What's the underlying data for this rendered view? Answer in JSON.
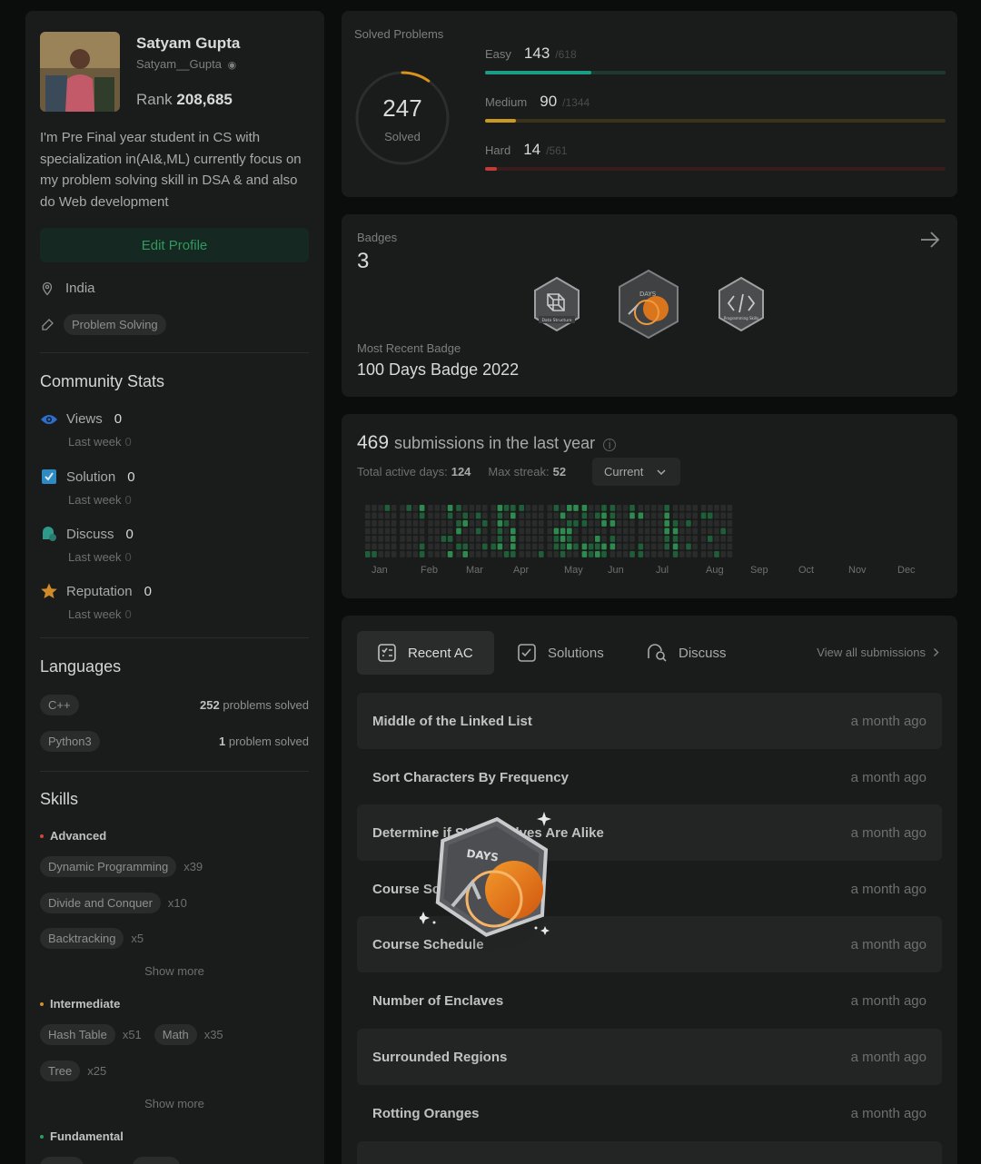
{
  "profile": {
    "name": "Satyam Gupta",
    "username": "Satyam__Gupta",
    "rank_label": "Rank",
    "rank_value": "208,685",
    "bio": "I'm Pre Final year student in CS with specialization in(AI&,ML) currently focus on my problem solving skill in DSA & and also do Web development",
    "edit_label": "Edit Profile",
    "location": "India",
    "tag": "Problem Solving"
  },
  "community": {
    "title": "Community Stats",
    "items": [
      {
        "label": "Views",
        "value": "0",
        "sub_label": "Last week",
        "sub_value": "0",
        "icon": "eye-icon",
        "color": "#2d6fd0"
      },
      {
        "label": "Solution",
        "value": "0",
        "sub_label": "Last week",
        "sub_value": "0",
        "icon": "check-square-icon",
        "color": "#2d8bc4"
      },
      {
        "label": "Discuss",
        "value": "0",
        "sub_label": "Last week",
        "sub_value": "0",
        "icon": "chat-icon",
        "color": "#2f9a8a"
      },
      {
        "label": "Reputation",
        "value": "0",
        "sub_label": "Last week",
        "sub_value": "0",
        "icon": "star-icon",
        "color": "#d08a2a"
      }
    ]
  },
  "languages": {
    "title": "Languages",
    "items": [
      {
        "name": "C++",
        "count": "252",
        "suffix": "problems solved"
      },
      {
        "name": "Python3",
        "count": "1",
        "suffix": "problem solved"
      }
    ]
  },
  "skills": {
    "title": "Skills",
    "show_more": "Show more",
    "advanced": {
      "label": "Advanced",
      "items": [
        {
          "name": "Dynamic Programming",
          "count": "x39"
        },
        {
          "name": "Divide and Conquer",
          "count": "x10"
        },
        {
          "name": "Backtracking",
          "count": "x5"
        }
      ]
    },
    "intermediate": {
      "label": "Intermediate",
      "items": [
        {
          "name": "Hash Table",
          "count": "x51"
        },
        {
          "name": "Math",
          "count": "x35"
        },
        {
          "name": "Tree",
          "count": "x25"
        }
      ]
    },
    "fundamental": {
      "label": "Fundamental"
    }
  },
  "solved": {
    "label": "Solved Problems",
    "total": "247",
    "total_label": "Solved",
    "easy": {
      "label": "Easy",
      "count": "143",
      "total": "/618",
      "fraction": 0.231
    },
    "medium": {
      "label": "Medium",
      "count": "90",
      "total": "/1344",
      "fraction": 0.067
    },
    "hard": {
      "label": "Hard",
      "count": "14",
      "total": "/561",
      "fraction": 0.025
    }
  },
  "badges": {
    "label": "Badges",
    "count": "3",
    "recent_label": "Most Recent Badge",
    "recent_value": "100 Days Badge 2022",
    "items": [
      {
        "name": "data-structure-badge-icon",
        "caption": "Data Structure"
      },
      {
        "name": "days-badge-icon",
        "caption": "DAYS"
      },
      {
        "name": "programming-skills-badge-icon",
        "caption": "Programming Skills"
      }
    ]
  },
  "submissions": {
    "count": "469",
    "text": "submissions in the last year",
    "active_label": "Total active days:",
    "active_value": "124",
    "streak_label": "Max streak:",
    "streak_value": "52",
    "select_value": "Current",
    "months": [
      "Jan",
      "Feb",
      "Mar",
      "Apr",
      "May",
      "Jun",
      "Jul",
      "Aug",
      "Sep",
      "Oct",
      "Nov",
      "Dec"
    ]
  },
  "recent": {
    "tabs": [
      {
        "label": "Recent AC",
        "icon": "list-icon"
      },
      {
        "label": "Solutions",
        "icon": "check-square-icon"
      },
      {
        "label": "Discuss",
        "icon": "chat-search-icon"
      }
    ],
    "view_all": "View all submissions",
    "rows": [
      {
        "title": "Middle of the Linked List",
        "time": "a month ago"
      },
      {
        "title": "Sort Characters By Frequency",
        "time": "a month ago"
      },
      {
        "title": "Determine if String Halves Are Alike",
        "time": "a month ago"
      },
      {
        "title": "Course Schedule II",
        "time": "a month ago"
      },
      {
        "title": "Course Schedule",
        "time": "a month ago"
      },
      {
        "title": "Number of Enclaves",
        "time": "a month ago"
      },
      {
        "title": "Surrounded Regions",
        "time": "a month ago"
      },
      {
        "title": "Rotting Oranges",
        "time": "a month ago"
      }
    ]
  },
  "overlay": {
    "badge_caption": "DAYS"
  }
}
